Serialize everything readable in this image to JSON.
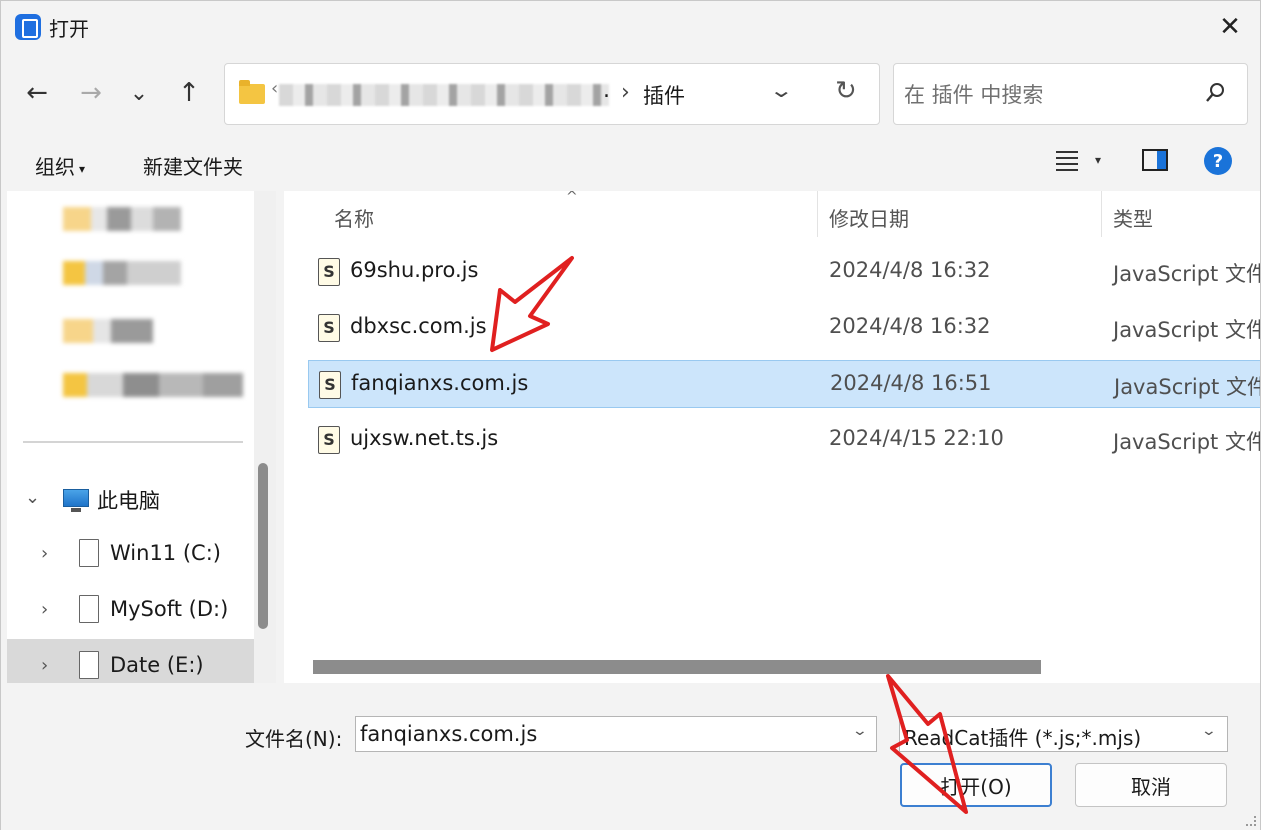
{
  "window": {
    "title": "打开",
    "close_glyph": "✕"
  },
  "nav": {
    "back_glyph": "←",
    "forward_glyph": "→",
    "recent_glyph": "⌄",
    "up_glyph": "↑",
    "address": {
      "prefix_glyph": "‹",
      "separator_glyph": "›",
      "trailing_dot": ".",
      "current_folder": "插件",
      "dropdown_glyph": "⌄",
      "refresh_glyph": "↻"
    },
    "search": {
      "placeholder": "在 插件 中搜索"
    }
  },
  "toolbar": {
    "organize_label": "组织",
    "organize_caret": "▾",
    "new_folder_label": "新建文件夹",
    "view_caret": "▾",
    "help_glyph": "?"
  },
  "tree": {
    "this_pc": {
      "label": "此电脑",
      "arrow": "⌄"
    },
    "drives": [
      {
        "label": "Win11 (C:)",
        "arrow": "›"
      },
      {
        "label": "MySoft (D:)",
        "arrow": "›"
      },
      {
        "label": "Date (E:)",
        "arrow": "›"
      }
    ]
  },
  "filelist": {
    "columns": {
      "name": "名称",
      "modified": "修改日期",
      "type": "类型"
    },
    "sort_glyph": "^",
    "files": [
      {
        "name": "69shu.pro.js",
        "modified": "2024/4/8 16:32",
        "type": "JavaScript 文件",
        "icon_glyph": "S"
      },
      {
        "name": "dbxsc.com.js",
        "modified": "2024/4/8 16:32",
        "type": "JavaScript 文件",
        "icon_glyph": "S"
      },
      {
        "name": "fanqianxs.com.js",
        "modified": "2024/4/8 16:51",
        "type": "JavaScript 文件",
        "icon_glyph": "S"
      },
      {
        "name": "ujxsw.net.ts.js",
        "modified": "2024/4/15 22:10",
        "type": "JavaScript 文件",
        "icon_glyph": "S"
      }
    ],
    "selected_index": 2
  },
  "footer": {
    "filename_label": "文件名(N):",
    "filename_value": "fanqianxs.com.js",
    "filetype_value": "ReadCat插件 (*.js;*.mjs)",
    "dropdown_glyph": "⌄",
    "open_label": "打开(O)",
    "cancel_label": "取消"
  },
  "colors": {
    "selection_bg": "#cce5fb",
    "accent_blue": "#1a73d9",
    "annotation_red": "#e02020"
  }
}
